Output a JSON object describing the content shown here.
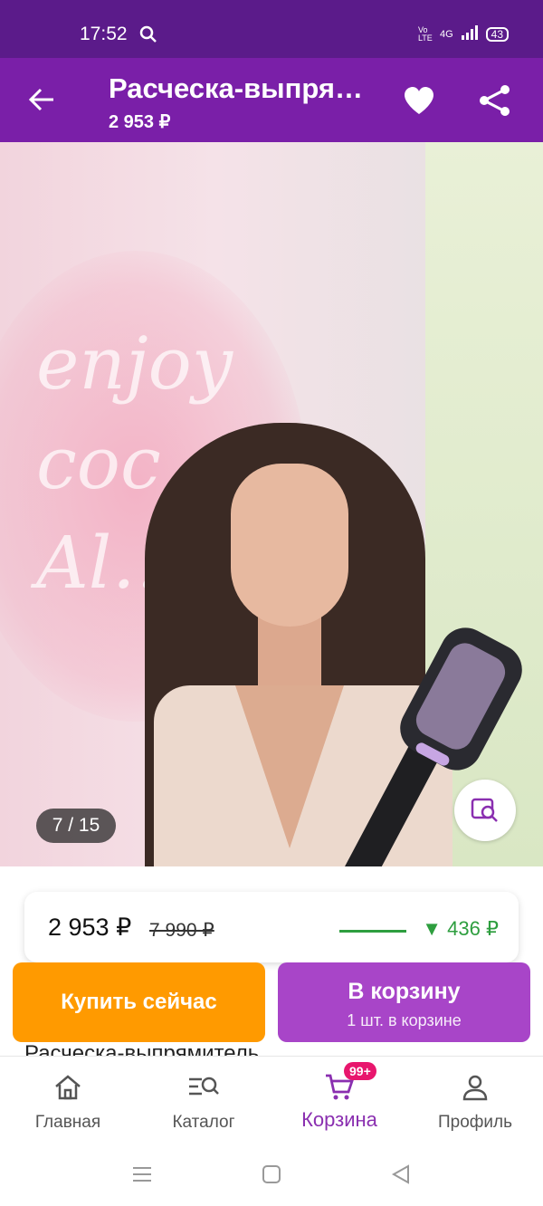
{
  "status_bar": {
    "time": "17:52",
    "network": "4G",
    "volte": "Vo LTE",
    "battery": "43"
  },
  "header": {
    "title": "Расческа-выпря…",
    "price": "2 953 ₽"
  },
  "gallery": {
    "counter": "7 / 15",
    "wall_text": "enjoy\ncoc\nAl…"
  },
  "price": {
    "current": "2 953 ₽",
    "old": "7 990 ₽",
    "drop": "▼ 436 ₽"
  },
  "buttons": {
    "buy_now": "Купить сейчас",
    "add_to_cart": "В корзину",
    "in_cart_note": "1 шт. в корзине"
  },
  "product": {
    "name_peek": "Расческа-выпрямитель"
  },
  "bottom_nav": {
    "items": [
      {
        "label": "Главная",
        "icon": "home-icon"
      },
      {
        "label": "Каталог",
        "icon": "catalog-search-icon"
      },
      {
        "label": "Корзина",
        "icon": "cart-icon",
        "badge": "99+",
        "active": true
      },
      {
        "label": "Профиль",
        "icon": "profile-icon"
      }
    ]
  },
  "colors": {
    "status_bar": "#5b1b8a",
    "app_bar": "#7a1fa8",
    "buy": "#ff9a00",
    "cart": "#a845c8",
    "price_drop": "#2e9e3f",
    "badge": "#e8166d"
  }
}
